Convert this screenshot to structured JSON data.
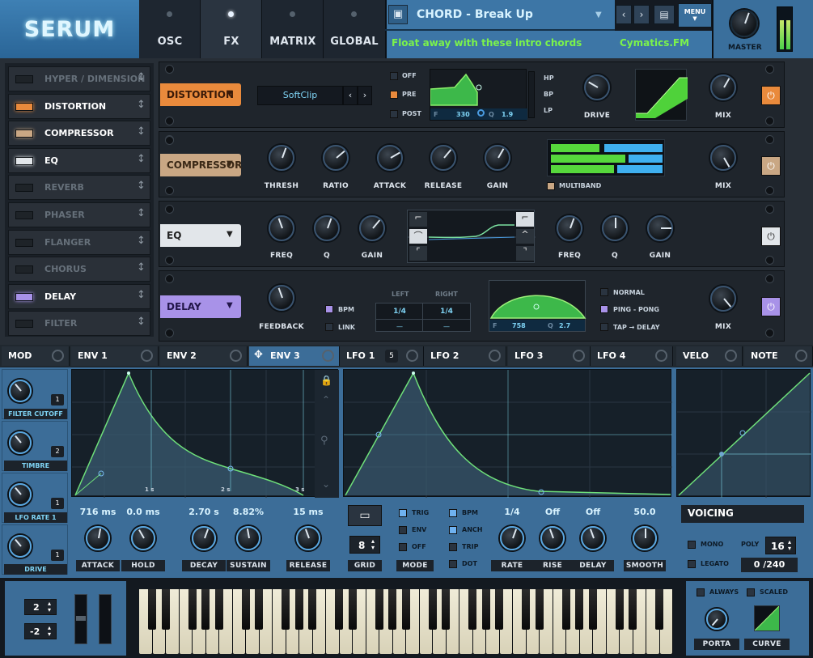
{
  "app": {
    "logo": "SERUM"
  },
  "tabs": [
    {
      "label": "OSC"
    },
    {
      "label": "FX"
    },
    {
      "label": "MATRIX"
    },
    {
      "label": "GLOBAL"
    }
  ],
  "preset": {
    "name": "CHORD - Break Up",
    "desc": "Float away with these intro chords",
    "author": "Cymatics.FM",
    "menu": "MENU",
    "master": "MASTER"
  },
  "fx_rack": [
    {
      "label": "HYPER / DIMENSION",
      "on": false
    },
    {
      "label": "DISTORTION",
      "on": true,
      "color": "#e98a3c"
    },
    {
      "label": "COMPRESSOR",
      "on": true,
      "color": "#c9a784"
    },
    {
      "label": "EQ",
      "on": true,
      "color": "#e2e6ea"
    },
    {
      "label": "REVERB",
      "on": false
    },
    {
      "label": "PHASER",
      "on": false
    },
    {
      "label": "FLANGER",
      "on": false
    },
    {
      "label": "CHORUS",
      "on": false
    },
    {
      "label": "DELAY",
      "on": true,
      "color": "#a892e8"
    },
    {
      "label": "FILTER",
      "on": false
    }
  ],
  "distortion": {
    "name": "DISTORTION",
    "mode": "SoftClip",
    "off": "OFF",
    "pre": "PRE",
    "post": "POST",
    "f_label": "F",
    "f_val": "330",
    "q_label": "Q",
    "q_val": "1.9",
    "hp": "HP",
    "bp": "BP",
    "lp": "LP",
    "drive": "DRIVE",
    "mix": "MIX"
  },
  "compressor": {
    "name": "COMPRESSOR",
    "knobs": [
      "THRESH",
      "RATIO",
      "ATTACK",
      "RELEASE",
      "GAIN"
    ],
    "multiband": "MULTIBAND",
    "mix": "MIX"
  },
  "eq": {
    "name": "EQ",
    "left_knobs": [
      "FREQ",
      "Q",
      "GAIN"
    ],
    "right_knobs": [
      "FREQ",
      "Q",
      "GAIN"
    ]
  },
  "delay": {
    "name": "DELAY",
    "feedback": "FEEDBACK",
    "bpm": "BPM",
    "link": "LINK",
    "left": "LEFT",
    "right": "RIGHT",
    "left_val": "1/4",
    "right_val": "1/4",
    "left_sub": "—",
    "right_sub": "—",
    "f_label": "F",
    "f_val": "758",
    "q_label": "Q",
    "q_val": "2.7",
    "normal": "NORMAL",
    "pingpong": "PING - PONG",
    "tap": "TAP → DELAY",
    "mix": "MIX"
  },
  "mod_tabs": {
    "mod": "MOD",
    "env1": "ENV 1",
    "env2": "ENV 2",
    "env3": "ENV 3",
    "lfo1": "LFO 1",
    "lfo1_badge": "5",
    "lfo2": "LFO 2",
    "lfo3": "LFO 3",
    "lfo4": "LFO 4",
    "velo": "VELO",
    "note": "NOTE"
  },
  "mod_slots": [
    {
      "label": "FILTER CUTOFF",
      "num": "1"
    },
    {
      "label": "TIMBRE",
      "num": "2"
    },
    {
      "label": "LFO RATE 1",
      "num": "1"
    },
    {
      "label": "DRIVE",
      "num": "1"
    }
  ],
  "env": {
    "ticks": [
      "1 s",
      "2 s",
      "3 s"
    ],
    "values": [
      "716 ms",
      "0.0 ms",
      "2.70 s",
      "8.82%",
      "15 ms"
    ],
    "labels": [
      "ATTACK",
      "HOLD",
      "DECAY",
      "SUSTAIN",
      "RELEASE"
    ]
  },
  "lfo": {
    "grid_label": "GRID",
    "grid_val": "8",
    "mode": "MODE",
    "trig": "TRIG",
    "env": "ENV",
    "off": "OFF",
    "bpm": "BPM",
    "anch": "ANCH",
    "trip": "TRIP",
    "dot": "DOT",
    "values": [
      "1/4",
      "Off",
      "Off",
      "50.0"
    ],
    "labels": [
      "RATE",
      "RISE",
      "DELAY",
      "SMOOTH"
    ]
  },
  "voicing": {
    "title": "VOICING",
    "mono": "MONO",
    "poly": "POLY",
    "poly_val": "16",
    "legato": "LEGATO",
    "legato_val": "0 /240"
  },
  "keyboard": {
    "oct1": "2",
    "oct2": "-2"
  },
  "porta": {
    "always": "ALWAYS",
    "scaled": "SCALED",
    "porta": "PORTA",
    "curve": "CURVE"
  }
}
